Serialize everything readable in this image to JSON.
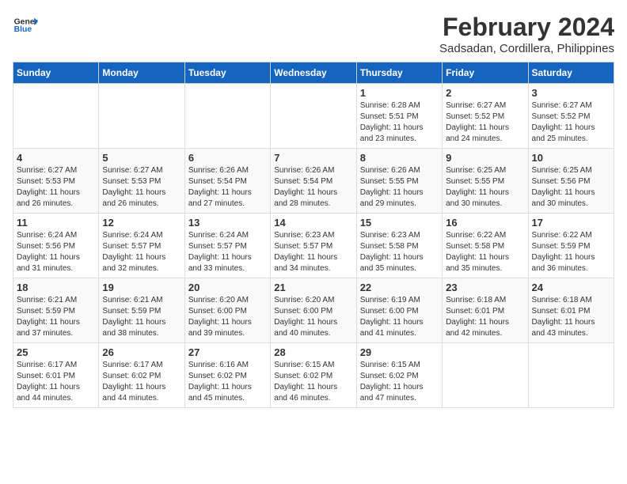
{
  "header": {
    "logo_line1": "General",
    "logo_line2": "Blue",
    "title": "February 2024",
    "subtitle": "Sadsadan, Cordillera, Philippines"
  },
  "weekdays": [
    "Sunday",
    "Monday",
    "Tuesday",
    "Wednesday",
    "Thursday",
    "Friday",
    "Saturday"
  ],
  "weeks": [
    [
      {
        "day": "",
        "info": ""
      },
      {
        "day": "",
        "info": ""
      },
      {
        "day": "",
        "info": ""
      },
      {
        "day": "",
        "info": ""
      },
      {
        "day": "1",
        "info": "Sunrise: 6:28 AM\nSunset: 5:51 PM\nDaylight: 11 hours\nand 23 minutes."
      },
      {
        "day": "2",
        "info": "Sunrise: 6:27 AM\nSunset: 5:52 PM\nDaylight: 11 hours\nand 24 minutes."
      },
      {
        "day": "3",
        "info": "Sunrise: 6:27 AM\nSunset: 5:52 PM\nDaylight: 11 hours\nand 25 minutes."
      }
    ],
    [
      {
        "day": "4",
        "info": "Sunrise: 6:27 AM\nSunset: 5:53 PM\nDaylight: 11 hours\nand 26 minutes."
      },
      {
        "day": "5",
        "info": "Sunrise: 6:27 AM\nSunset: 5:53 PM\nDaylight: 11 hours\nand 26 minutes."
      },
      {
        "day": "6",
        "info": "Sunrise: 6:26 AM\nSunset: 5:54 PM\nDaylight: 11 hours\nand 27 minutes."
      },
      {
        "day": "7",
        "info": "Sunrise: 6:26 AM\nSunset: 5:54 PM\nDaylight: 11 hours\nand 28 minutes."
      },
      {
        "day": "8",
        "info": "Sunrise: 6:26 AM\nSunset: 5:55 PM\nDaylight: 11 hours\nand 29 minutes."
      },
      {
        "day": "9",
        "info": "Sunrise: 6:25 AM\nSunset: 5:55 PM\nDaylight: 11 hours\nand 30 minutes."
      },
      {
        "day": "10",
        "info": "Sunrise: 6:25 AM\nSunset: 5:56 PM\nDaylight: 11 hours\nand 30 minutes."
      }
    ],
    [
      {
        "day": "11",
        "info": "Sunrise: 6:24 AM\nSunset: 5:56 PM\nDaylight: 11 hours\nand 31 minutes."
      },
      {
        "day": "12",
        "info": "Sunrise: 6:24 AM\nSunset: 5:57 PM\nDaylight: 11 hours\nand 32 minutes."
      },
      {
        "day": "13",
        "info": "Sunrise: 6:24 AM\nSunset: 5:57 PM\nDaylight: 11 hours\nand 33 minutes."
      },
      {
        "day": "14",
        "info": "Sunrise: 6:23 AM\nSunset: 5:57 PM\nDaylight: 11 hours\nand 34 minutes."
      },
      {
        "day": "15",
        "info": "Sunrise: 6:23 AM\nSunset: 5:58 PM\nDaylight: 11 hours\nand 35 minutes."
      },
      {
        "day": "16",
        "info": "Sunrise: 6:22 AM\nSunset: 5:58 PM\nDaylight: 11 hours\nand 35 minutes."
      },
      {
        "day": "17",
        "info": "Sunrise: 6:22 AM\nSunset: 5:59 PM\nDaylight: 11 hours\nand 36 minutes."
      }
    ],
    [
      {
        "day": "18",
        "info": "Sunrise: 6:21 AM\nSunset: 5:59 PM\nDaylight: 11 hours\nand 37 minutes."
      },
      {
        "day": "19",
        "info": "Sunrise: 6:21 AM\nSunset: 5:59 PM\nDaylight: 11 hours\nand 38 minutes."
      },
      {
        "day": "20",
        "info": "Sunrise: 6:20 AM\nSunset: 6:00 PM\nDaylight: 11 hours\nand 39 minutes."
      },
      {
        "day": "21",
        "info": "Sunrise: 6:20 AM\nSunset: 6:00 PM\nDaylight: 11 hours\nand 40 minutes."
      },
      {
        "day": "22",
        "info": "Sunrise: 6:19 AM\nSunset: 6:00 PM\nDaylight: 11 hours\nand 41 minutes."
      },
      {
        "day": "23",
        "info": "Sunrise: 6:18 AM\nSunset: 6:01 PM\nDaylight: 11 hours\nand 42 minutes."
      },
      {
        "day": "24",
        "info": "Sunrise: 6:18 AM\nSunset: 6:01 PM\nDaylight: 11 hours\nand 43 minutes."
      }
    ],
    [
      {
        "day": "25",
        "info": "Sunrise: 6:17 AM\nSunset: 6:01 PM\nDaylight: 11 hours\nand 44 minutes."
      },
      {
        "day": "26",
        "info": "Sunrise: 6:17 AM\nSunset: 6:02 PM\nDaylight: 11 hours\nand 44 minutes."
      },
      {
        "day": "27",
        "info": "Sunrise: 6:16 AM\nSunset: 6:02 PM\nDaylight: 11 hours\nand 45 minutes."
      },
      {
        "day": "28",
        "info": "Sunrise: 6:15 AM\nSunset: 6:02 PM\nDaylight: 11 hours\nand 46 minutes."
      },
      {
        "day": "29",
        "info": "Sunrise: 6:15 AM\nSunset: 6:02 PM\nDaylight: 11 hours\nand 47 minutes."
      },
      {
        "day": "",
        "info": ""
      },
      {
        "day": "",
        "info": ""
      }
    ]
  ]
}
